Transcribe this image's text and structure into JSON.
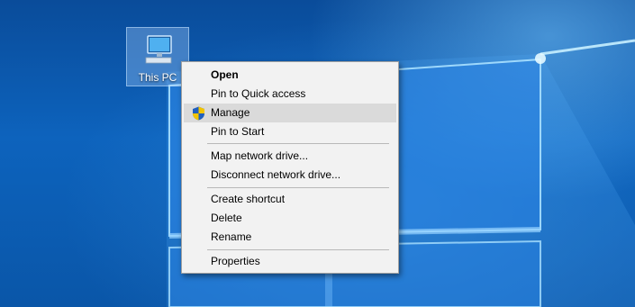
{
  "desktop": {
    "icon": {
      "label": "This PC",
      "icon_name": "this-pc-icon"
    }
  },
  "context_menu": {
    "items": [
      {
        "label": "Open",
        "bold": true
      },
      {
        "label": "Pin to Quick access"
      },
      {
        "label": "Manage",
        "highlighted": true,
        "icon_name": "uac-shield-icon"
      },
      {
        "label": "Pin to Start"
      },
      {
        "label": "Map network drive..."
      },
      {
        "label": "Disconnect network drive..."
      },
      {
        "label": "Create shortcut"
      },
      {
        "label": "Delete"
      },
      {
        "label": "Rename"
      },
      {
        "label": "Properties"
      }
    ]
  },
  "colors": {
    "wallpaper_blue": "#0d63bd",
    "menu_background": "#f2f2f2",
    "menu_highlight": "#dadada"
  }
}
